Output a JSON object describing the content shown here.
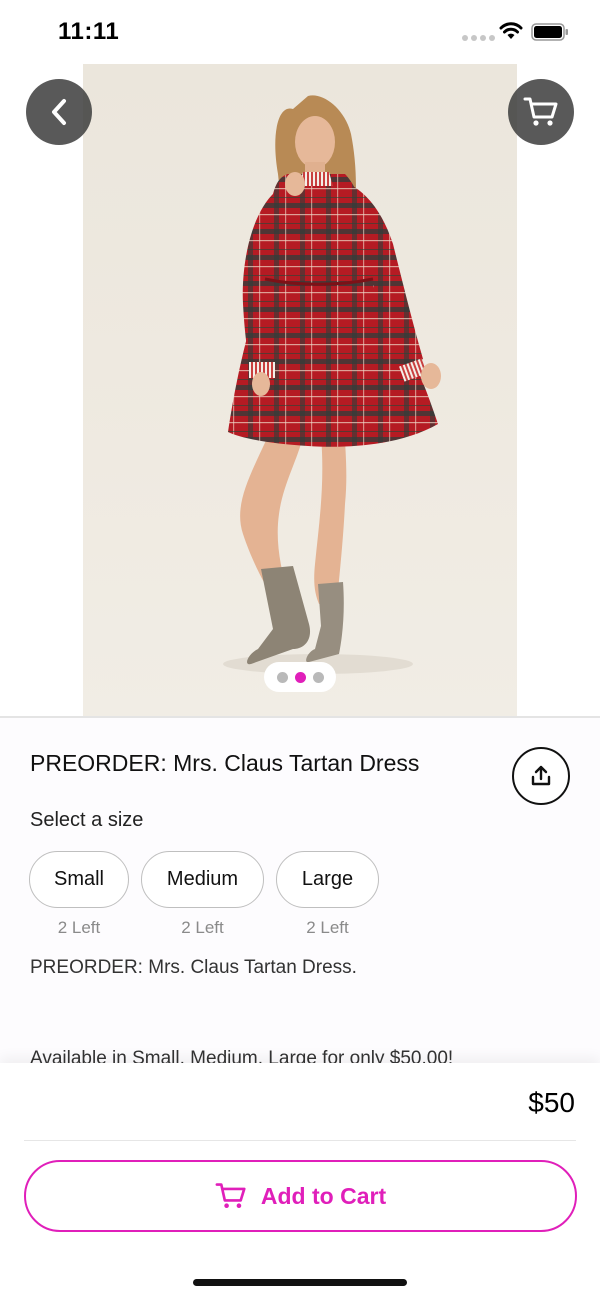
{
  "status_bar": {
    "time": "11:11",
    "wifi_icon": "wifi-icon",
    "battery_icon": "battery-icon"
  },
  "gallery": {
    "image_count": 3,
    "active_index": 1,
    "back_icon": "chevron-left-icon",
    "cart_icon": "cart-icon",
    "active_dot_color": "#e01fba"
  },
  "product": {
    "title": "PREORDER: Mrs. Claus Tartan Dress",
    "share_icon": "share-icon",
    "size_prompt": "Select a size",
    "sizes": [
      {
        "label": "Small",
        "stock": "2 Left"
      },
      {
        "label": "Medium",
        "stock": "2 Left"
      },
      {
        "label": "Large",
        "stock": "2 Left"
      }
    ],
    "description": [
      "PREORDER: Mrs. Claus Tartan Dress.",
      "Available in Small, Medium, Large for only $50.00!"
    ]
  },
  "checkout": {
    "price": "$50",
    "add_to_cart_label": "Add to Cart",
    "accent_color": "#e01fba"
  }
}
